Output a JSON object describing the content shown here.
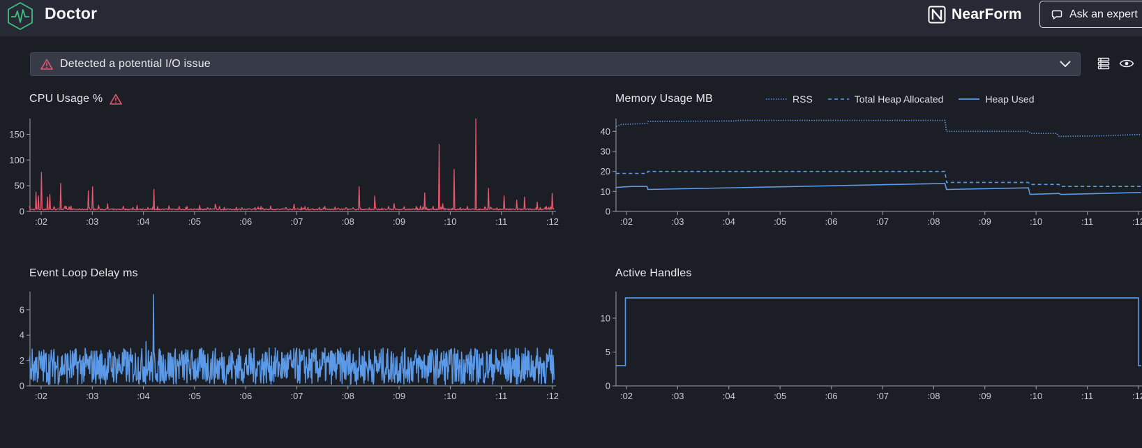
{
  "header": {
    "app_title": "Doctor",
    "brand": "NearForm",
    "expert_button": "Ask an expert",
    "logo_icon": "heartbeat-hexagon-icon"
  },
  "alert": {
    "text": "Detected a potential I/O issue",
    "icon": "warning-triangle-icon",
    "color": "#e8576e"
  },
  "toolbar": {
    "icons": [
      "list-view-icon",
      "eye-icon"
    ]
  },
  "colors": {
    "cpu": "#e8576e",
    "memory": "#5b9ae8",
    "background": "#1c1e26",
    "header": "#272a34"
  },
  "panels": {
    "cpu": {
      "title": "CPU Usage %"
    },
    "memory": {
      "title": "Memory Usage MB"
    },
    "event_loop": {
      "title": "Event Loop Delay ms"
    },
    "handles": {
      "title": "Active Handles"
    }
  },
  "memory_legend": {
    "rss": "RSS",
    "total_heap": "Total Heap Allocated",
    "heap_used": "Heap Used"
  },
  "chart_data": [
    {
      "id": "cpu",
      "type": "line",
      "title": "CPU Usage %",
      "x_ticks": [
        ":02",
        ":03",
        ":04",
        ":05",
        ":06",
        ":07",
        ":08",
        ":09",
        ":10",
        ":11",
        ":12"
      ],
      "y_ticks": [
        0,
        50,
        100,
        150
      ],
      "ylim": [
        0,
        175
      ],
      "baseline": 3,
      "spikes": [
        {
          "x": 1.9,
          "y": 38
        },
        {
          "x": 1.95,
          "y": 30
        },
        {
          "x": 2.0,
          "y": 76
        },
        {
          "x": 2.12,
          "y": 28
        },
        {
          "x": 2.17,
          "y": 33
        },
        {
          "x": 2.38,
          "y": 55
        },
        {
          "x": 2.92,
          "y": 40
        },
        {
          "x": 3.0,
          "y": 48
        },
        {
          "x": 3.12,
          "y": 12
        },
        {
          "x": 3.3,
          "y": 15
        },
        {
          "x": 3.6,
          "y": 10
        },
        {
          "x": 3.88,
          "y": 12
        },
        {
          "x": 4.2,
          "y": 43
        },
        {
          "x": 4.5,
          "y": 11
        },
        {
          "x": 4.7,
          "y": 10
        },
        {
          "x": 5.1,
          "y": 12
        },
        {
          "x": 5.4,
          "y": 14
        },
        {
          "x": 6.3,
          "y": 10
        },
        {
          "x": 6.95,
          "y": 14
        },
        {
          "x": 7.55,
          "y": 10
        },
        {
          "x": 8.22,
          "y": 48
        },
        {
          "x": 8.52,
          "y": 30
        },
        {
          "x": 8.9,
          "y": 15
        },
        {
          "x": 9.5,
          "y": 36
        },
        {
          "x": 9.78,
          "y": 130
        },
        {
          "x": 9.85,
          "y": 15
        },
        {
          "x": 10.08,
          "y": 82
        },
        {
          "x": 10.5,
          "y": 180
        },
        {
          "x": 10.75,
          "y": 45
        },
        {
          "x": 11.05,
          "y": 30
        },
        {
          "x": 11.3,
          "y": 22
        },
        {
          "x": 11.45,
          "y": 28
        },
        {
          "x": 11.7,
          "y": 18
        },
        {
          "x": 12.0,
          "y": 35
        }
      ]
    },
    {
      "id": "memory",
      "type": "line",
      "title": "Memory Usage MB",
      "x_ticks": [
        ":02",
        ":03",
        ":04",
        ":05",
        ":06",
        ":07",
        ":08",
        ":09",
        ":10",
        ":11",
        ":12"
      ],
      "y_ticks": [
        0,
        10,
        20,
        30,
        40
      ],
      "ylim": [
        0,
        45
      ],
      "series": [
        {
          "name": "RSS",
          "style": "dotted",
          "points": [
            [
              1.8,
              42.5
            ],
            [
              1.9,
              43.5
            ],
            [
              2.4,
              44
            ],
            [
              2.42,
              45
            ],
            [
              4.1,
              45.2
            ],
            [
              4.2,
              45.5
            ],
            [
              8.22,
              45.5
            ],
            [
              8.25,
              40
            ],
            [
              9.85,
              40
            ],
            [
              9.9,
              39
            ],
            [
              10.4,
              39
            ],
            [
              10.45,
              37.5
            ],
            [
              11.3,
              37.8
            ],
            [
              12.05,
              38.5
            ]
          ]
        },
        {
          "name": "Total Heap Allocated",
          "style": "dashed",
          "points": [
            [
              1.8,
              19
            ],
            [
              2.4,
              19
            ],
            [
              2.42,
              20
            ],
            [
              8.22,
              20
            ],
            [
              8.25,
              14.5
            ],
            [
              9.85,
              14.5
            ],
            [
              9.88,
              13.5
            ],
            [
              10.45,
              13.5
            ],
            [
              10.48,
              12.5
            ],
            [
              12.05,
              12.5
            ]
          ]
        },
        {
          "name": "Heap Used",
          "style": "solid",
          "points": [
            [
              1.8,
              12
            ],
            [
              2.1,
              12.5
            ],
            [
              2.4,
              12.5
            ],
            [
              2.42,
              11
            ],
            [
              8.22,
              14
            ],
            [
              8.25,
              11
            ],
            [
              9.85,
              11.8
            ],
            [
              9.88,
              8.5
            ],
            [
              10.45,
              9
            ],
            [
              10.48,
              8.5
            ],
            [
              12.05,
              9.5
            ]
          ]
        }
      ]
    },
    {
      "id": "event_loop",
      "type": "line",
      "title": "Event Loop Delay ms",
      "x_ticks": [
        ":02",
        ":03",
        ":04",
        ":05",
        ":06",
        ":07",
        ":08",
        ":09",
        ":10",
        ":11",
        ":12"
      ],
      "y_ticks": [
        0,
        2,
        4,
        6
      ],
      "ylim": [
        0,
        7.2
      ],
      "band": [
        0.1,
        3.0
      ],
      "spikes": [
        {
          "x": 4.05,
          "y": 3.5
        },
        {
          "x": 4.2,
          "y": 7.2
        }
      ]
    },
    {
      "id": "handles",
      "type": "line",
      "title": "Active Handles",
      "x_ticks": [
        ":02",
        ":03",
        ":04",
        ":05",
        ":06",
        ":07",
        ":08",
        ":09",
        ":10",
        ":11",
        ":12"
      ],
      "y_ticks": [
        0,
        5,
        10
      ],
      "ylim": [
        0,
        13.5
      ],
      "points": [
        [
          1.8,
          3
        ],
        [
          1.98,
          3
        ],
        [
          1.98,
          13
        ],
        [
          12.0,
          13
        ],
        [
          12.0,
          3
        ],
        [
          12.05,
          3
        ]
      ]
    }
  ]
}
